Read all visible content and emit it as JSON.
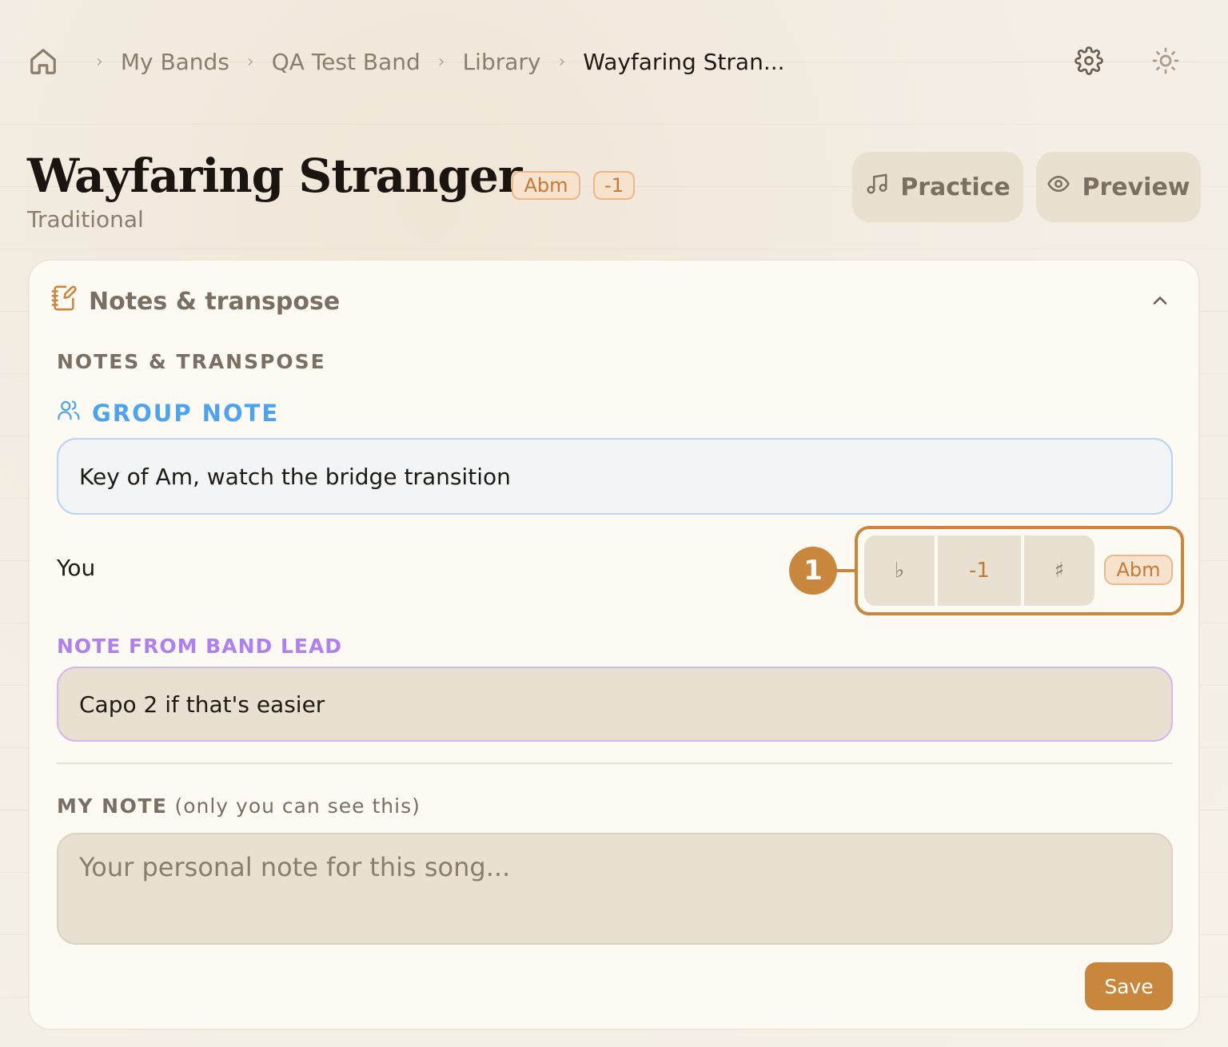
{
  "breadcrumb": {
    "home_icon": "home-icon",
    "items": [
      "My Bands",
      "QA Test Band",
      "Library",
      "Wayfaring Stran..."
    ],
    "separator": "›"
  },
  "header_icons": [
    "gear-icon",
    "sun-icon"
  ],
  "song": {
    "title": "Wayfaring Stranger",
    "key": "Abm",
    "transpose": "-1",
    "artist": "Traditional"
  },
  "actions": {
    "practice": "Practice",
    "preview": "Preview"
  },
  "notes_panel": {
    "header": "Notes & transpose",
    "section_label": "NOTES & TRANSPOSE",
    "group_note_label": "GROUP NOTE",
    "group_note_value": "Key of Am, watch the bridge transition",
    "you_label": "You",
    "callout_number": "1",
    "transpose": {
      "flat": "♭",
      "amount": "-1",
      "sharp": "♯",
      "key": "Abm"
    },
    "band_lead_label": "NOTE FROM BAND LEAD",
    "band_lead_value": "Capo 2 if that's easier",
    "my_note_label": "MY NOTE",
    "my_note_hint": "(only you can see this)",
    "my_note_placeholder": "Your personal note for this song...",
    "save": "Save"
  },
  "colors": {
    "accent": "#c9873d",
    "group_blue": "#4da3ef",
    "lead_purple": "#b07ff0",
    "muted_text": "#7a6f62"
  }
}
